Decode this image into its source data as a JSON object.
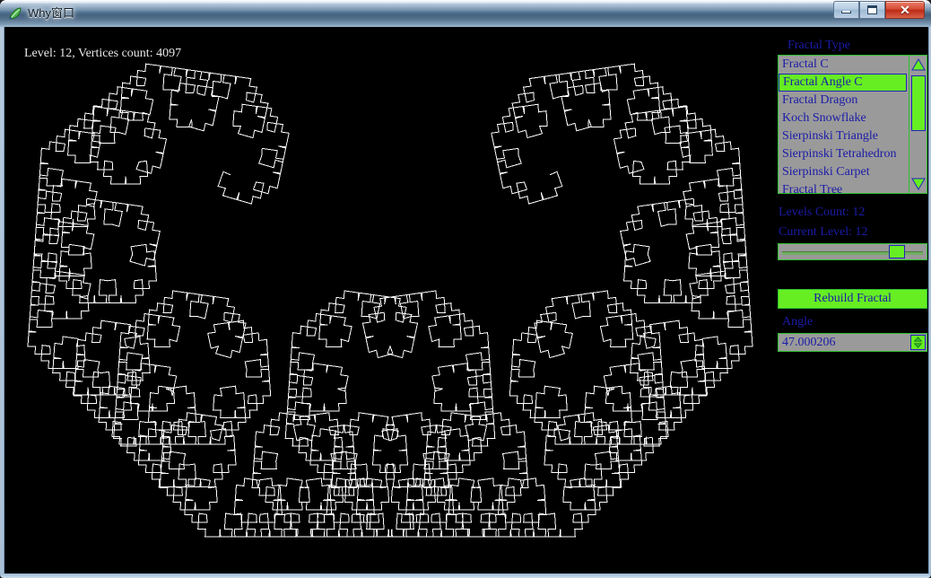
{
  "window": {
    "title": "Why窗口",
    "icon": "leaf-app-icon",
    "buttons": {
      "minimize": "minimize-icon",
      "maximize": "maximize-icon",
      "close": "✕"
    }
  },
  "viewport": {
    "hud": "Level: 12, Vertices count: 4097",
    "background_color": "#000000",
    "stroke_color": "#ffffff"
  },
  "panel": {
    "fractal_type_label": "Fractal Type",
    "fractal_types": [
      "Fractal C",
      "Fractal Angle C",
      "Fractal Dragon",
      "Koch Snowflake",
      "Sierpinski Triangle",
      "Sierpinski Tetrahedron",
      "Sierpinski Carpet",
      "Fractal Tree"
    ],
    "selected_fractal_type": "Fractal Angle C",
    "selected_index": 1,
    "scrollbar": {
      "up_arrow": "triangle-up-icon",
      "down_arrow": "triangle-down-icon"
    },
    "levels_count_label": "Levels Count: 12",
    "current_level_label": "Current Level: 12",
    "level_slider": {
      "value": 12,
      "min": 0,
      "max": 15
    },
    "rebuild_button": "Rebuild Fractal",
    "angle_label": "Angle",
    "angle_value": "47.000206",
    "accent_green": "#66ee22",
    "label_blue": "#1b1ba8",
    "control_gray": "#9a9a9a"
  },
  "fractal": {
    "type": "levy-c-curve",
    "angle_degrees": 47.000206,
    "level": 12,
    "vertices": 4097
  }
}
